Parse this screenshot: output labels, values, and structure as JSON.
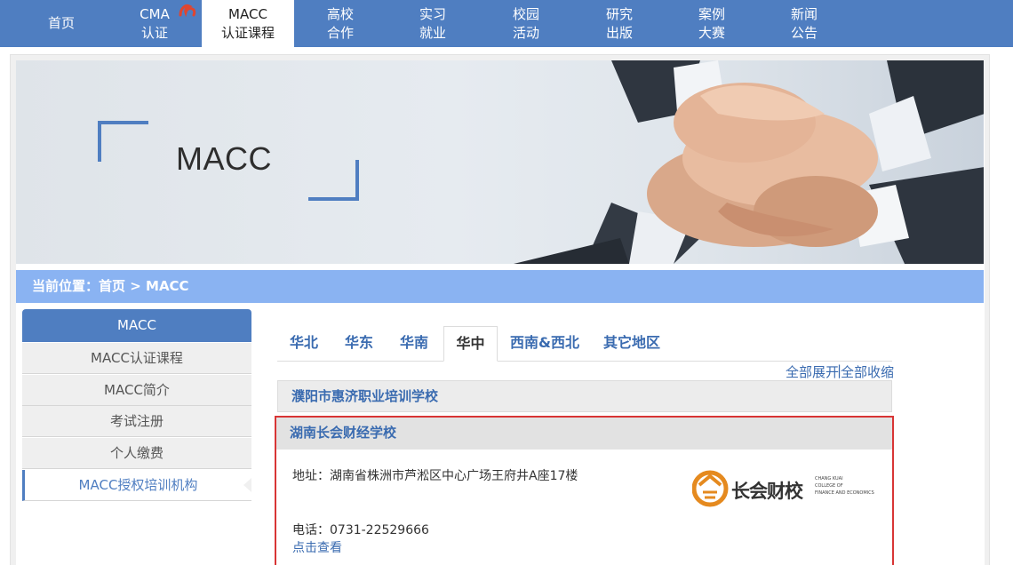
{
  "nav": {
    "items": [
      {
        "line1": "首页",
        "line2": ""
      },
      {
        "line1": "CMA",
        "line2": "认证"
      },
      {
        "line1": "MACC",
        "line2": "认证课程"
      },
      {
        "line1": "高校",
        "line2": "合作"
      },
      {
        "line1": "实习",
        "line2": "就业"
      },
      {
        "line1": "校园",
        "line2": "活动"
      },
      {
        "line1": "研究",
        "line2": "出版"
      },
      {
        "line1": "案例",
        "line2": "大赛"
      },
      {
        "line1": "新闻",
        "line2": "公告"
      }
    ],
    "active_index": 2,
    "accent": "#4f7ec1"
  },
  "banner": {
    "title": "MACC"
  },
  "breadcrumb": {
    "text": "当前位置：首页 > MACC"
  },
  "sidebar": {
    "header": "MACC",
    "items": [
      {
        "label": "MACC认证课程"
      },
      {
        "label": "MACC简介"
      },
      {
        "label": "考试注册"
      },
      {
        "label": "个人缴费"
      },
      {
        "label": "MACC授权培训机构"
      }
    ],
    "active_index": 4
  },
  "tabs": {
    "items": [
      "华北",
      "华东",
      "华南",
      "华中",
      "西南&西北",
      "其它地区"
    ],
    "active_index": 3
  },
  "controls": {
    "expand_all": "全部展开",
    "separator": "|",
    "collapse_all": "全部收缩"
  },
  "schools": [
    {
      "name": "濮阳市惠济职业培训学校"
    },
    {
      "name": "湖南长会财经学校",
      "address": "地址：湖南省株洲市芦淞区中心广场王府井A座17楼",
      "phone": "电话：0731-22529666",
      "link": "点击查看",
      "logo": {
        "text": "长会财校",
        "sub1": "CHANG KUAI",
        "sub2": "COLLEGE OF",
        "sub3": "FINANCE AND ECONOMICS",
        "color": "#e58a1f"
      }
    }
  ]
}
